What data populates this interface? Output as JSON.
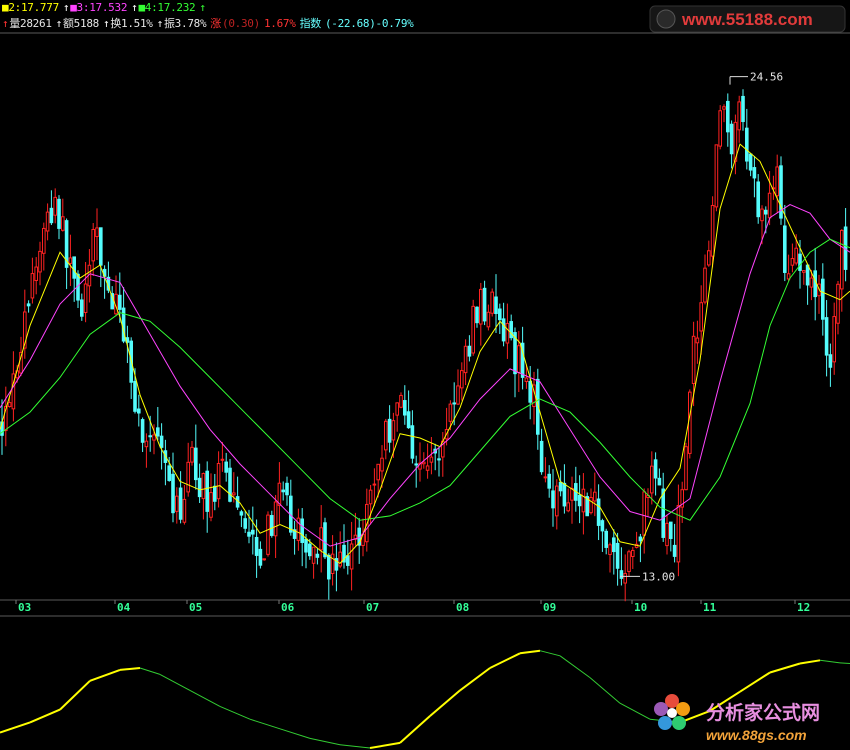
{
  "header": {
    "row1": [
      {
        "text": "■2:17.777",
        "color": "#ffff00"
      },
      {
        "text": "↑",
        "color": "#ffffff"
      },
      {
        "text": "■3:17.532",
        "color": "#ff44ff"
      },
      {
        "text": "↑",
        "color": "#ffffff"
      },
      {
        "text": "■4:17.232",
        "color": "#33ff33"
      },
      {
        "text": "↑",
        "color": "#33ff33"
      }
    ],
    "row2": [
      {
        "text": "↑",
        "color": "#ff3333"
      },
      {
        "text": "量28261",
        "color": "#e6e6e6"
      },
      {
        "text": "↑",
        "color": "#ffffff"
      },
      {
        "text": "额5188",
        "color": "#e6e6e6"
      },
      {
        "text": "↑",
        "color": "#ffffff"
      },
      {
        "text": "换1.51%",
        "color": "#e6e6e6"
      },
      {
        "text": "↑",
        "color": "#ffffff"
      },
      {
        "text": "振3.78%",
        "color": "#e6e6e6"
      },
      {
        "text": "涨",
        "color": "#ff3333"
      },
      {
        "text": "(0.30)",
        "color": "#bb2222"
      },
      {
        "text": "1.67%",
        "color": "#ff3333"
      },
      {
        "text": "指数",
        "color": "#66ffff"
      },
      {
        "text": "(-22.68)-0.79%",
        "color": "#66ffff"
      }
    ]
  },
  "watermarks": {
    "top": "www.55188.com",
    "bottom_cn": "分析家公式网",
    "bottom_url": "www.88gs.com"
  },
  "chart_data": [
    {
      "type": "candlestick",
      "annotations": [
        {
          "label": "24.56",
          "kind": "period-high"
        },
        {
          "label": "13.00",
          "kind": "period-low"
        }
      ],
      "x_ticks": [
        "03",
        "04",
        "05",
        "06",
        "07",
        "08",
        "09",
        "10",
        "11",
        "12"
      ],
      "price_range": [
        12.5,
        25.5
      ],
      "ma_legend": [
        {
          "name": "2",
          "value": 17.777,
          "color": "#ffff00"
        },
        {
          "name": "3",
          "value": 17.532,
          "color": "#ff44ff"
        },
        {
          "name": "4",
          "value": 17.232,
          "color": "#33ff33"
        }
      ],
      "up_color": "#ff2222",
      "down_color": "#54fcfc",
      "price_path": [
        [
          0,
          16.5
        ],
        [
          20,
          18.3
        ],
        [
          38,
          20.5
        ],
        [
          55,
          21.8
        ],
        [
          68,
          20.3
        ],
        [
          82,
          19.3
        ],
        [
          96,
          20.9
        ],
        [
          108,
          19.6
        ],
        [
          125,
          18.7
        ],
        [
          140,
          16.4
        ],
        [
          158,
          16.0
        ],
        [
          175,
          14.3
        ],
        [
          192,
          15.6
        ],
        [
          208,
          14.8
        ],
        [
          222,
          15.3
        ],
        [
          235,
          14.9
        ],
        [
          248,
          14.2
        ],
        [
          262,
          13.6
        ],
        [
          278,
          14.8
        ],
        [
          292,
          14.3
        ],
        [
          305,
          13.5
        ],
        [
          318,
          13.9
        ],
        [
          332,
          13.2
        ],
        [
          345,
          13.3
        ],
        [
          358,
          14.0
        ],
        [
          372,
          15.0
        ],
        [
          385,
          16.2
        ],
        [
          400,
          17.2
        ],
        [
          413,
          16.0
        ],
        [
          425,
          15.5
        ],
        [
          438,
          15.8
        ],
        [
          450,
          16.9
        ],
        [
          462,
          17.5
        ],
        [
          475,
          19.2
        ],
        [
          490,
          19.4
        ],
        [
          505,
          18.5
        ],
        [
          520,
          17.9
        ],
        [
          532,
          17.3
        ],
        [
          542,
          15.8
        ],
        [
          555,
          14.8
        ],
        [
          568,
          15.1
        ],
        [
          580,
          14.9
        ],
        [
          592,
          14.8
        ],
        [
          600,
          14.4
        ],
        [
          610,
          13.8
        ],
        [
          620,
          13.0
        ],
        [
          632,
          13.4
        ],
        [
          645,
          14.6
        ],
        [
          655,
          15.5
        ],
        [
          665,
          14.0
        ],
        [
          675,
          13.3
        ],
        [
          688,
          17.0
        ],
        [
          698,
          19.0
        ],
        [
          712,
          21.5
        ],
        [
          722,
          24.0
        ],
        [
          730,
          23.1
        ],
        [
          742,
          23.7
        ],
        [
          755,
          21.9
        ],
        [
          765,
          21.3
        ],
        [
          775,
          22.6
        ],
        [
          785,
          20.1
        ],
        [
          795,
          20.8
        ],
        [
          808,
          19.3
        ],
        [
          818,
          19.9
        ],
        [
          830,
          17.8
        ],
        [
          842,
          20.8
        ],
        [
          850,
          19.9
        ]
      ],
      "moving_averages": [
        {
          "name": "2",
          "color": "#ffff00",
          "points": [
            [
              0,
              16.4
            ],
            [
              30,
              18.8
            ],
            [
              60,
              20.5
            ],
            [
              80,
              19.9
            ],
            [
              100,
              20.2
            ],
            [
              120,
              19.0
            ],
            [
              140,
              17.2
            ],
            [
              160,
              16.0
            ],
            [
              180,
              15.2
            ],
            [
              200,
              15.0
            ],
            [
              220,
              15.1
            ],
            [
              240,
              14.7
            ],
            [
              260,
              14.0
            ],
            [
              280,
              14.2
            ],
            [
              300,
              14.0
            ],
            [
              320,
              13.6
            ],
            [
              340,
              13.3
            ],
            [
              360,
              13.8
            ],
            [
              380,
              15.0
            ],
            [
              400,
              16.3
            ],
            [
              420,
              16.2
            ],
            [
              440,
              16.0
            ],
            [
              460,
              16.9
            ],
            [
              480,
              18.2
            ],
            [
              500,
              18.9
            ],
            [
              520,
              18.4
            ],
            [
              540,
              16.8
            ],
            [
              560,
              15.2
            ],
            [
              580,
              14.9
            ],
            [
              600,
              14.6
            ],
            [
              620,
              13.8
            ],
            [
              640,
              13.7
            ],
            [
              660,
              14.8
            ],
            [
              680,
              15.5
            ],
            [
              700,
              18.0
            ],
            [
              720,
              21.5
            ],
            [
              740,
              23.0
            ],
            [
              760,
              22.6
            ],
            [
              780,
              21.6
            ],
            [
              800,
              20.6
            ],
            [
              820,
              19.6
            ],
            [
              840,
              19.4
            ],
            [
              850,
              19.6
            ]
          ]
        },
        {
          "name": "3",
          "color": "#ff44ff",
          "points": [
            [
              0,
              16.9
            ],
            [
              30,
              18.0
            ],
            [
              60,
              19.3
            ],
            [
              90,
              20.0
            ],
            [
              120,
              19.8
            ],
            [
              150,
              18.6
            ],
            [
              180,
              17.4
            ],
            [
              210,
              16.4
            ],
            [
              240,
              15.6
            ],
            [
              270,
              14.9
            ],
            [
              300,
              14.2
            ],
            [
              330,
              13.7
            ],
            [
              360,
              13.9
            ],
            [
              390,
              14.8
            ],
            [
              420,
              15.6
            ],
            [
              450,
              16.2
            ],
            [
              480,
              17.1
            ],
            [
              510,
              17.8
            ],
            [
              540,
              17.5
            ],
            [
              570,
              16.4
            ],
            [
              600,
              15.3
            ],
            [
              630,
              14.5
            ],
            [
              660,
              14.3
            ],
            [
              690,
              14.8
            ],
            [
              720,
              17.5
            ],
            [
              750,
              20.0
            ],
            [
              770,
              21.3
            ],
            [
              790,
              21.6
            ],
            [
              810,
              21.4
            ],
            [
              830,
              20.8
            ],
            [
              850,
              20.5
            ]
          ]
        },
        {
          "name": "4",
          "color": "#33ff33",
          "points": [
            [
              0,
              16.3
            ],
            [
              30,
              16.8
            ],
            [
              60,
              17.6
            ],
            [
              90,
              18.6
            ],
            [
              120,
              19.1
            ],
            [
              150,
              18.9
            ],
            [
              180,
              18.3
            ],
            [
              210,
              17.6
            ],
            [
              240,
              16.9
            ],
            [
              270,
              16.2
            ],
            [
              300,
              15.5
            ],
            [
              330,
              14.8
            ],
            [
              360,
              14.3
            ],
            [
              390,
              14.4
            ],
            [
              420,
              14.7
            ],
            [
              450,
              15.1
            ],
            [
              480,
              15.9
            ],
            [
              510,
              16.7
            ],
            [
              540,
              17.1
            ],
            [
              570,
              16.8
            ],
            [
              600,
              16.1
            ],
            [
              630,
              15.3
            ],
            [
              660,
              14.6
            ],
            [
              690,
              14.3
            ],
            [
              720,
              15.3
            ],
            [
              750,
              17.0
            ],
            [
              770,
              18.8
            ],
            [
              790,
              19.9
            ],
            [
              810,
              20.5
            ],
            [
              830,
              20.8
            ],
            [
              850,
              20.6
            ]
          ]
        }
      ]
    },
    {
      "type": "line",
      "x_ticks": [],
      "y_range": [
        -1,
        1
      ],
      "series": [
        {
          "points": [
            [
              0,
              -0.76
            ],
            [
              30,
              -0.6
            ],
            [
              60,
              -0.4
            ],
            [
              90,
              0.05
            ],
            [
              120,
              0.22
            ],
            [
              140,
              0.25
            ],
            [
              160,
              0.15
            ],
            [
              190,
              -0.1
            ],
            [
              220,
              -0.35
            ],
            [
              250,
              -0.55
            ],
            [
              280,
              -0.7
            ],
            [
              310,
              -0.85
            ],
            [
              340,
              -0.95
            ],
            [
              370,
              -1.0
            ],
            [
              400,
              -0.92
            ],
            [
              430,
              -0.5
            ],
            [
              460,
              -0.1
            ],
            [
              490,
              0.25
            ],
            [
              520,
              0.48
            ],
            [
              540,
              0.52
            ],
            [
              560,
              0.44
            ],
            [
              590,
              0.1
            ],
            [
              620,
              -0.3
            ],
            [
              650,
              -0.55
            ],
            [
              680,
              -0.6
            ],
            [
              710,
              -0.42
            ],
            [
              740,
              -0.12
            ],
            [
              770,
              0.18
            ],
            [
              800,
              0.32
            ],
            [
              820,
              0.37
            ],
            [
              840,
              0.33
            ],
            [
              850,
              0.32
            ]
          ]
        }
      ],
      "segment_colors": {
        "rising": "#ffff00",
        "falling": "#33cc33"
      }
    }
  ]
}
